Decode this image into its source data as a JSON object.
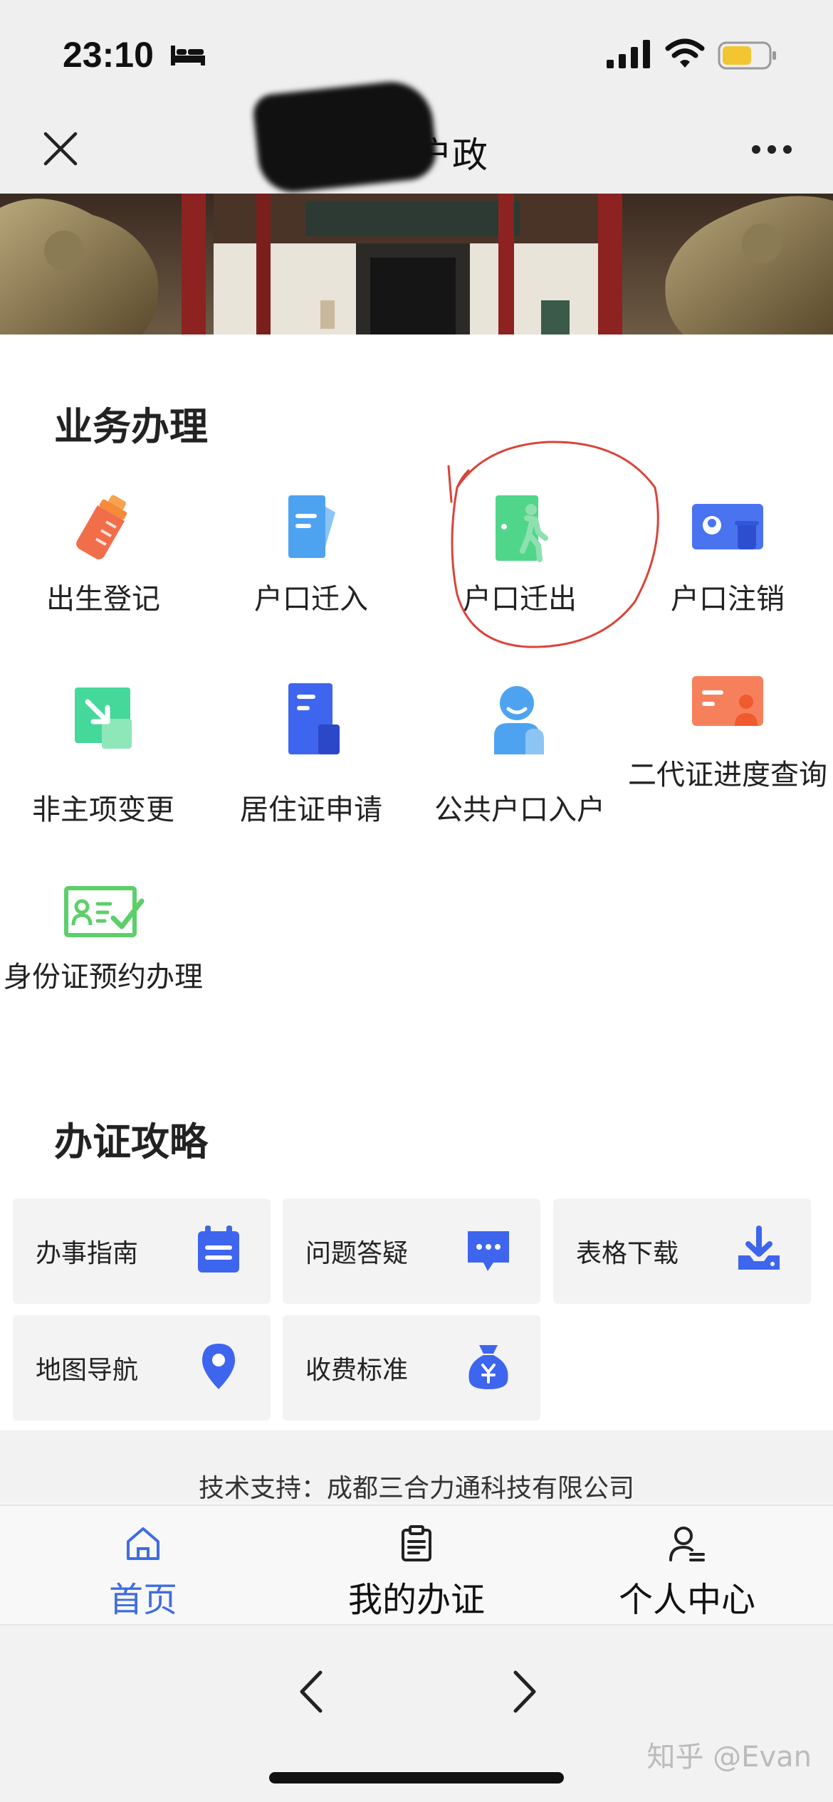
{
  "status_bar": {
    "time": "23:10"
  },
  "title_bar": {
    "title": "安微户政"
  },
  "services": {
    "heading": "业务办理",
    "items": [
      {
        "label": "出生登记",
        "icon": "baby-bottle-icon"
      },
      {
        "label": "户口迁入",
        "icon": "document-in-icon"
      },
      {
        "label": "户口迁出",
        "icon": "door-exit-icon"
      },
      {
        "label": "户口注销",
        "icon": "id-card-icon"
      },
      {
        "label": "非主项变更",
        "icon": "arrow-change-icon"
      },
      {
        "label": "居住证申请",
        "icon": "residence-document-icon"
      },
      {
        "label": "公共户口入户",
        "icon": "person-icon"
      },
      {
        "label": "二代证进度查询",
        "icon": "card-query-icon"
      },
      {
        "label": "身份证预约办理",
        "icon": "id-appointment-icon"
      }
    ]
  },
  "guides": {
    "heading": "办证攻略",
    "items": [
      {
        "label": "办事指南",
        "icon": "calendar-icon"
      },
      {
        "label": "问题答疑",
        "icon": "chat-icon"
      },
      {
        "label": "表格下载",
        "icon": "download-icon"
      },
      {
        "label": "地图导航",
        "icon": "location-pin-icon"
      },
      {
        "label": "收费标准",
        "icon": "money-bag-icon"
      }
    ]
  },
  "footer": {
    "text": "技术支持：成都三合力通科技有限公司"
  },
  "tabbar": {
    "tabs": [
      {
        "label": "首页",
        "icon": "home-icon",
        "active": true
      },
      {
        "label": "我的办证",
        "icon": "clipboard-icon",
        "active": false
      },
      {
        "label": "个人中心",
        "icon": "user-icon",
        "active": false
      }
    ]
  },
  "watermark": "知乎 @Evan",
  "colors": {
    "accent": "#3f6de0",
    "annotation": "#d9443a"
  }
}
